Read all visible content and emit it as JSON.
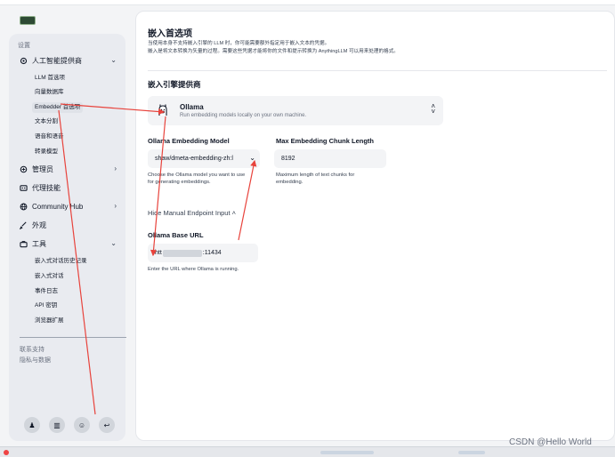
{
  "sidebar": {
    "section_settings": "设置",
    "ai_providers": {
      "label": "人工智能提供商",
      "items": [
        "LLM 首选项",
        "向量数据库",
        "Embedder 首选项",
        "文本分割",
        "语音和语音",
        "转录模型"
      ]
    },
    "admin": "管理员",
    "agent_skills": "代理技能",
    "community_hub": "Community Hub",
    "appearance": "外观",
    "tools": {
      "label": "工具",
      "items": [
        "嵌入式对话历史记录",
        "嵌入式对话",
        "事件日志",
        "API 密钥",
        "浏览器扩展"
      ]
    },
    "contact_support": "联系支持",
    "privacy": "隐私与数据"
  },
  "main": {
    "title": "嵌入首选项",
    "desc_line1": "当使用本身不支持嵌入引擎的 LLM 时，你可能需要额外指定用于嵌入文本的凭据。",
    "desc_line2": "嵌入是将文本转换为矢量的过程。需要这些凭据才能将你的文件和提示转换为 AnythingLLM 可以用来处理的格式。",
    "provider_heading": "嵌入引擎提供商",
    "provider": {
      "name": "Ollama",
      "description": "Run embedding models locally on your own machine."
    },
    "embedding_model": {
      "label": "Ollama Embedding Model",
      "value": "shaw/dmeta-embedding-zh:l",
      "help_line1": "Choose the Ollama model you want to use",
      "help_line2": "for generating embeddings."
    },
    "chunk_length": {
      "label": "Max Embedding Chunk Length",
      "value": "8192",
      "help_line1": "Maximum length of text chunks for",
      "help_line2": "embedding."
    },
    "toggle_label": "Hide Manual Endpoint Input",
    "base_url": {
      "label": "Ollama Base URL",
      "value_prefix": "htt",
      "value_suffix": ":11434",
      "help": "Enter the URL where Ollama is running."
    }
  },
  "watermark": "CSDN @Hello World",
  "colors": {
    "annotation_arrow": "#e8433c",
    "panel_bg": "#e9ebf0",
    "field_bg": "#f3f4f6"
  }
}
